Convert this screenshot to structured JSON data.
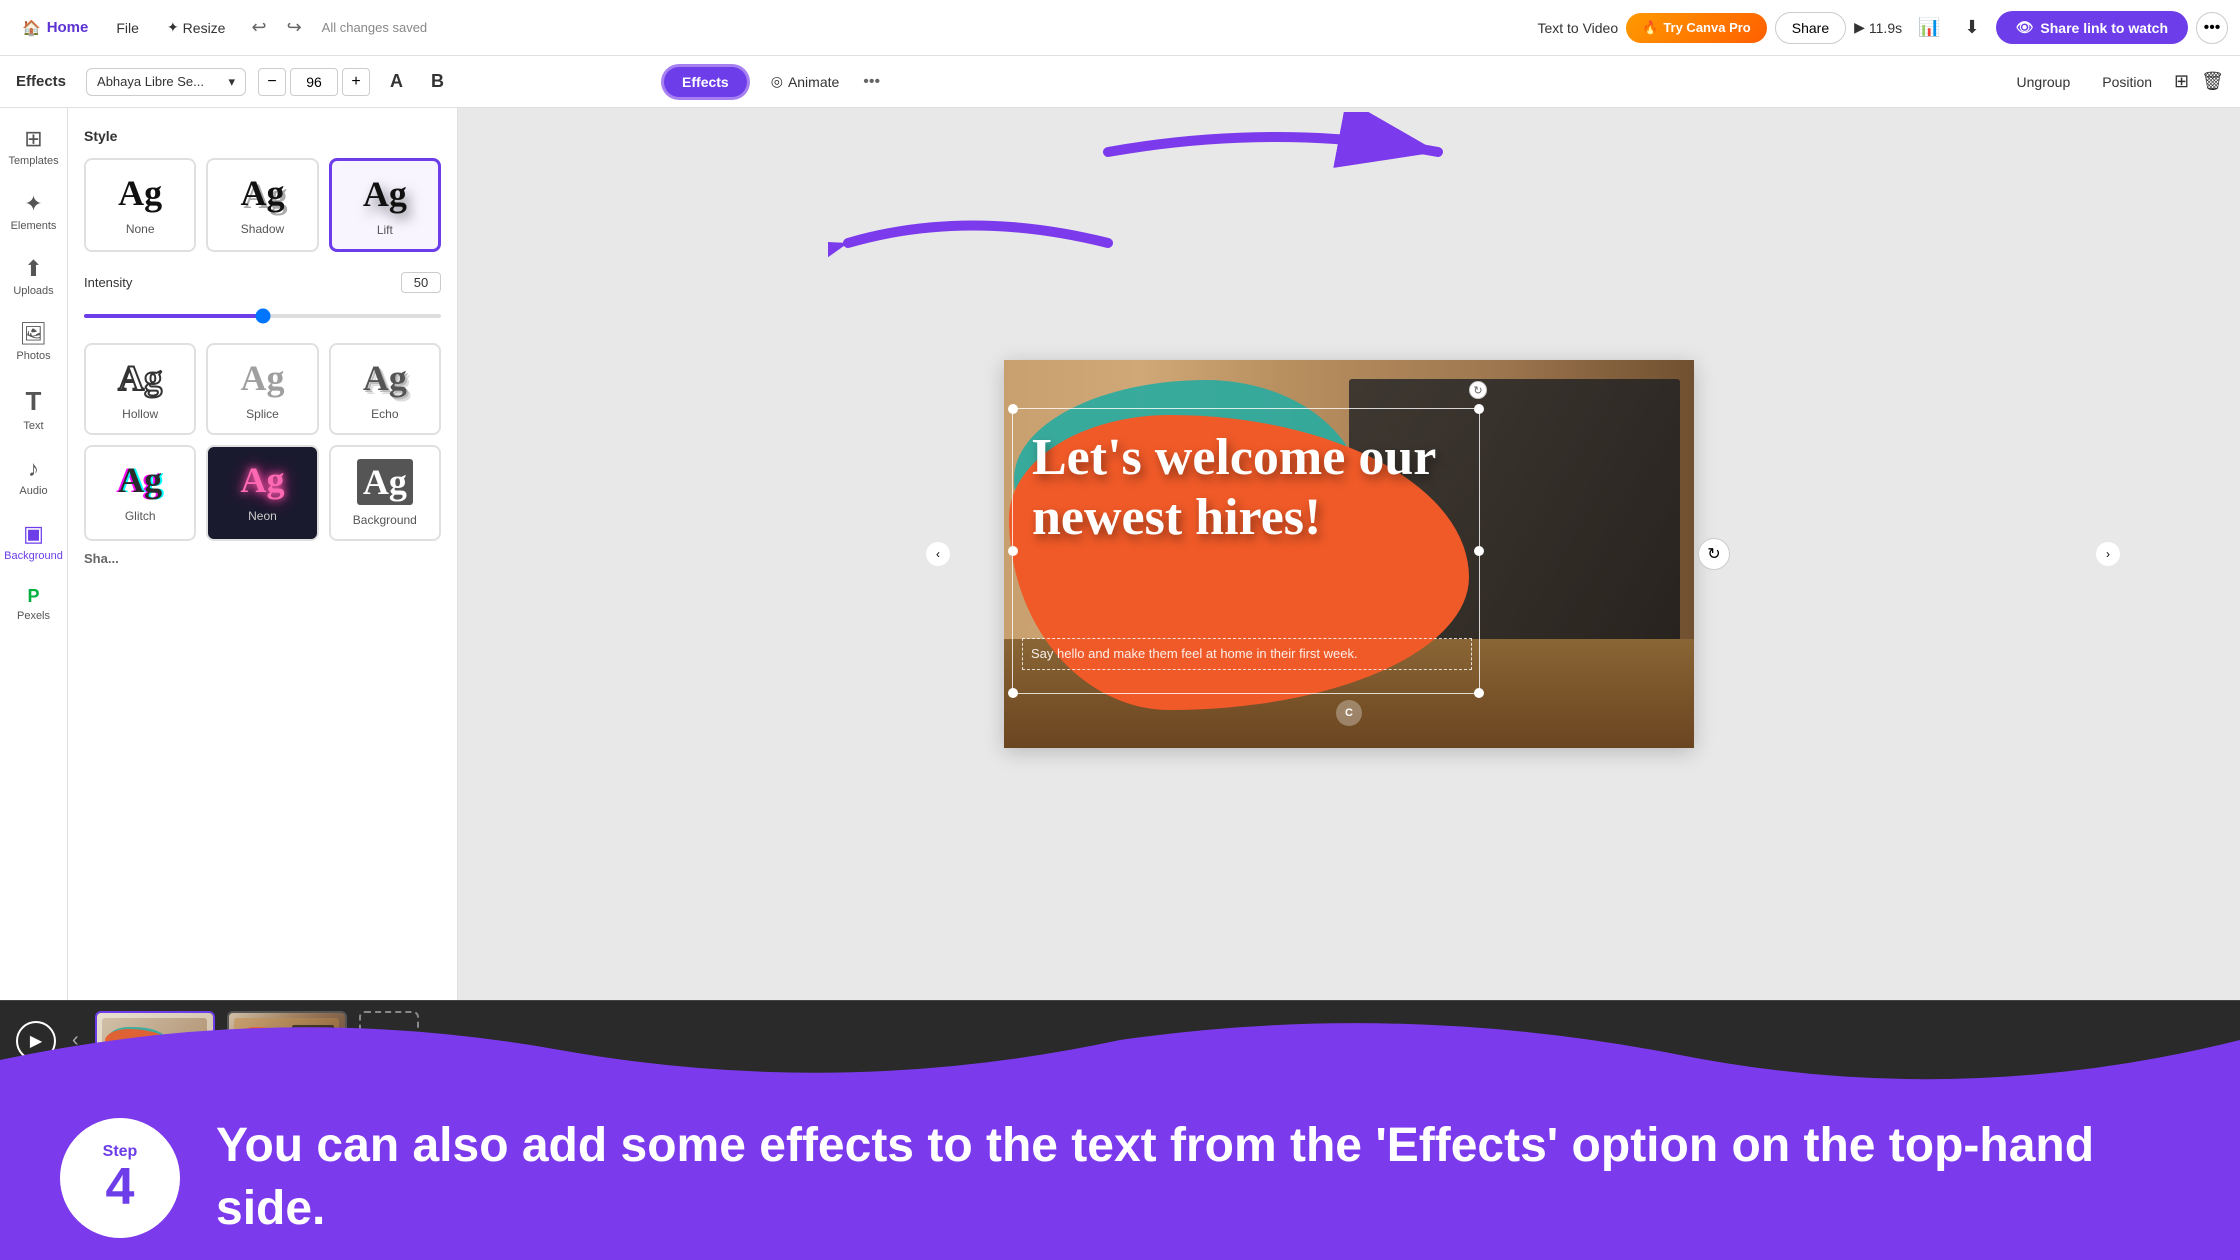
{
  "topNav": {
    "home_label": "Home",
    "file_label": "File",
    "resize_label": "Resize",
    "undo_symbol": "↩",
    "redo_symbol": "↪",
    "saved_text": "All changes saved",
    "text_to_video_label": "Text to Video",
    "try_pro_label": "Try Canva Pro",
    "share_label": "Share",
    "timer_label": "11.9s",
    "share_watch_label": "Share link to watch",
    "more_symbol": "•••"
  },
  "secondaryToolbar": {
    "panel_title": "Effects",
    "font_name": "Abhaya Libre Se...",
    "minus_symbol": "−",
    "plus_symbol": "+",
    "font_size": "96",
    "bold_symbol": "B",
    "effects_label": "Effects",
    "animate_label": "Animate",
    "more_symbol": "•••",
    "ungroup_label": "Ungroup",
    "position_label": "Position"
  },
  "effectsPanel": {
    "style_title": "Style",
    "intensity_label": "Intensity",
    "intensity_value": "50",
    "shape_label": "Sha...",
    "styles": [
      {
        "id": "none",
        "label": "None",
        "preview_text": "Ag",
        "effect": "none"
      },
      {
        "id": "shadow",
        "label": "Shadow",
        "preview_text": "Ag",
        "effect": "shadow"
      },
      {
        "id": "lift",
        "label": "Lift",
        "preview_text": "Ag",
        "effect": "lift"
      },
      {
        "id": "hollow",
        "label": "Hollow",
        "preview_text": "Ag",
        "effect": "hollow"
      },
      {
        "id": "splice",
        "label": "Splice",
        "preview_text": "Ag",
        "effect": "splice"
      },
      {
        "id": "echo",
        "label": "Echo",
        "preview_text": "Ag",
        "effect": "echo"
      },
      {
        "id": "glitch",
        "label": "Glitch",
        "preview_text": "Ag",
        "effect": "glitch"
      },
      {
        "id": "neon",
        "label": "Neon",
        "preview_text": "Ag",
        "effect": "neon"
      },
      {
        "id": "background",
        "label": "Background",
        "preview_text": "Ag",
        "effect": "background-style"
      }
    ]
  },
  "canvas": {
    "headline": "Let's welcome our newest hires!",
    "subtext": "Say hello and make them feel at home in their first week.",
    "rotate_symbol": "↻"
  },
  "timeline": {
    "play_symbol": "▶",
    "add_symbol": "+"
  },
  "sidebar": {
    "items": [
      {
        "id": "templates",
        "label": "Templates",
        "icon": "⊞"
      },
      {
        "id": "elements",
        "label": "Elements",
        "icon": "✦"
      },
      {
        "id": "uploads",
        "label": "Uploads",
        "icon": "↑"
      },
      {
        "id": "photos",
        "label": "Photos",
        "icon": "🖼"
      },
      {
        "id": "text",
        "label": "Text",
        "icon": "T"
      },
      {
        "id": "audio",
        "label": "Audio",
        "icon": "♪"
      },
      {
        "id": "background",
        "label": "Background",
        "icon": "▣"
      },
      {
        "id": "pexels",
        "label": "Pexels",
        "icon": "P"
      }
    ]
  },
  "step": {
    "step_label": "Step",
    "step_number": "4",
    "description": "You can also add some effects to the text from the 'Effects' option on the top-hand side."
  },
  "annotations": {
    "arrow_right_label": "→",
    "arrow_left_label": "←"
  }
}
